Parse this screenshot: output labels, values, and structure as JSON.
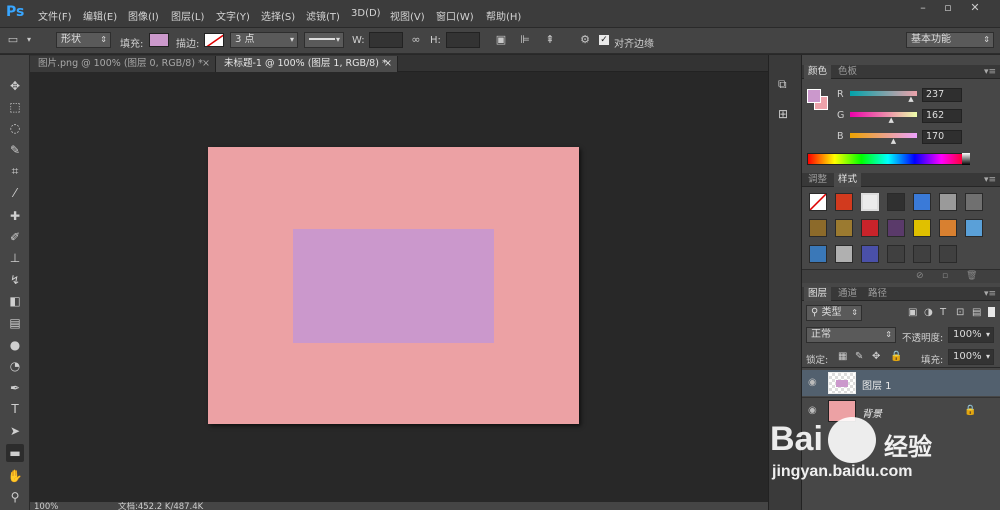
{
  "app": {
    "logo": "Ps",
    "menus": [
      "文件(F)",
      "编辑(E)",
      "图像(I)",
      "图层(L)",
      "文字(Y)",
      "选择(S)",
      "滤镜(T)",
      "3D(D)",
      "视图(V)",
      "窗口(W)",
      "帮助(H)"
    ],
    "window_controls": [
      "minimize-icon",
      "restore-icon",
      "close-icon"
    ]
  },
  "options": {
    "mode": "形状",
    "fill_label": "填充:",
    "fill_color": "#cc99cc",
    "stroke_label": "描边:",
    "stroke_size": "3 点",
    "w_label": "W:",
    "h_label": "H:",
    "align_edges_label": "对齐边缘",
    "align_edges_checked": true,
    "workspace": "基本功能"
  },
  "tabs": [
    {
      "label": "图片.png @ 100% (图层 0, RGB/8) *",
      "active": false
    },
    {
      "label": "未标题-1 @ 100% (图层 1, RGB/8) *",
      "active": true
    }
  ],
  "status": {
    "zoom": "100%",
    "doc_info": "文档:452.2 K/487.4K"
  },
  "canvas": {
    "background_color": "#eca1a4",
    "shape_color": "#cb98cc"
  },
  "color_panel": {
    "tabs": [
      "颜色",
      "色板"
    ],
    "r_label": "R",
    "g_label": "G",
    "b_label": "B",
    "r": "237",
    "g": "162",
    "b": "170",
    "r_level": 0.929,
    "g_level": 0.635,
    "b_level": 0.667,
    "foreground": "#cb98cc",
    "background": "#eda2aa"
  },
  "styles_panel": {
    "tabs": [
      "调整",
      "样式"
    ],
    "swatch_colors": [
      "#ffffff",
      "#d23a1e",
      "#ececec",
      "#303030",
      "#3a7ad8",
      "#9a9a9a",
      "#707070",
      "#8c6a2a",
      "#9b7a30",
      "#c8232a",
      "#5a3a6a",
      "#e0c000",
      "#d88030",
      "#5aa0d8",
      "#3a78b8",
      "#b0b0b0",
      "#4a50a8",
      "#404040",
      "#404040",
      "#404040"
    ]
  },
  "layers_panel": {
    "tabs": [
      "图层",
      "通道",
      "路径"
    ],
    "filter_label": "类型",
    "blend_mode": "正常",
    "opacity_label": "不透明度:",
    "opacity": "100%",
    "lock_label": "锁定:",
    "fill_label": "填充:",
    "fill": "100%",
    "layers": [
      {
        "name": "图层 1",
        "selected": true
      },
      {
        "name": "背景",
        "selected": false
      }
    ]
  },
  "watermark": {
    "brand": "Bai",
    "brand_cn": "经验",
    "url": "jingyan.baidu.com"
  }
}
